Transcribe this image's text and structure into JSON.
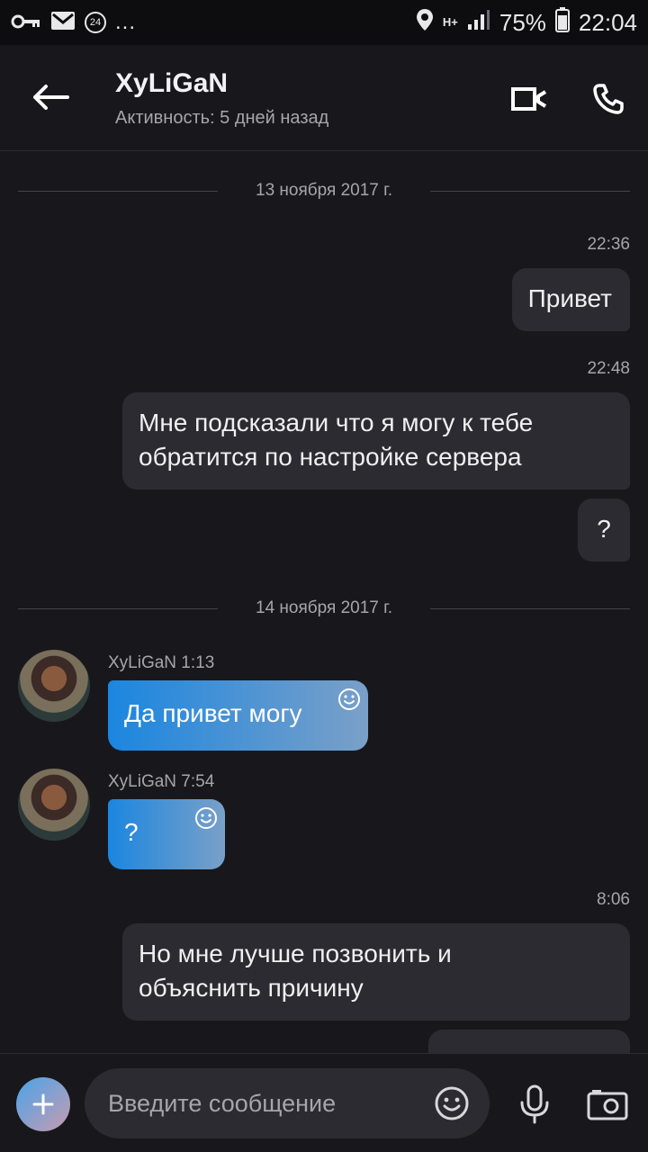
{
  "status_bar": {
    "battery": "75%",
    "time": "22:04",
    "notif_badge": "24",
    "overflow": "...",
    "network": "H+"
  },
  "header": {
    "title": "XyLiGaN",
    "subtitle": "Активность: 5 дней назад"
  },
  "messages": {
    "date1": "13 ноября 2017 г.",
    "t1": "22:36",
    "m1": "Привет",
    "t2": "22:48",
    "m2_line1": "Мне подсказали что я могу к тебе",
    "m2_line2": "обратится по настройке сервера",
    "m3": "?",
    "date2": "14 ноября 2017 г.",
    "in1_sender": "XyLiGaN 1:13",
    "in1_text": "Да привет могу",
    "in2_sender": "XyLiGaN 7:54",
    "in2_text": "?",
    "t3": "8:06",
    "m4_line1": "Но мне лучше позвонить и",
    "m4_line2": "объяснить причину"
  },
  "composer": {
    "placeholder": "Введите сообщение"
  },
  "colors": {
    "background": "#18181c",
    "bubble_out": "#2b2b31",
    "bubble_in_start": "#1b86e0",
    "bubble_in_end": "#7aa0c8"
  }
}
